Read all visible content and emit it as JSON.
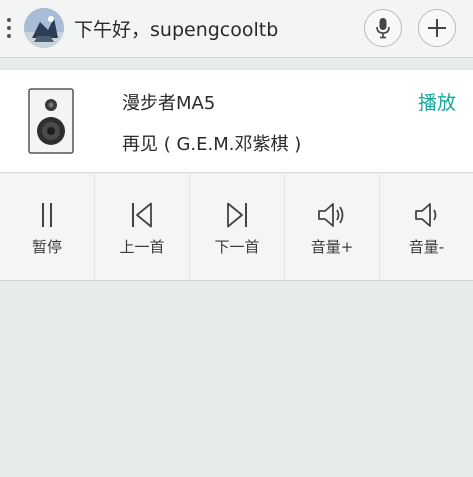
{
  "header": {
    "greeting": "下午好，supengcooltb",
    "icons": [
      "menu-dots-icon",
      "avatar",
      "microphone-icon",
      "plus-icon"
    ]
  },
  "device": {
    "name": "漫步者MA5",
    "track": "再见 ( G.E.M.邓紫棋 )",
    "play_label": "播放",
    "accent_color": "#17a89b"
  },
  "controls": [
    {
      "label": "暂停",
      "icon": "pause-icon"
    },
    {
      "label": "上一首",
      "icon": "previous-icon"
    },
    {
      "label": "下一首",
      "icon": "next-icon"
    },
    {
      "label": "音量+",
      "icon": "volume-up-icon"
    },
    {
      "label": "音量-",
      "icon": "volume-down-icon"
    }
  ]
}
